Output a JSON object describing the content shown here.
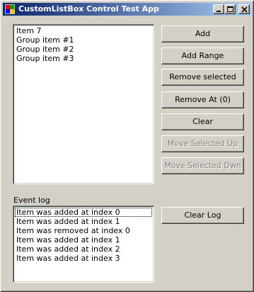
{
  "window": {
    "title": "CustomListBox Control Test App"
  },
  "items_list": {
    "items": [
      "Item 7",
      "Group item #1",
      "Group item #2",
      "Group item #3"
    ]
  },
  "buttons": {
    "add": "Add",
    "add_range": "Add Range",
    "remove_selected": "Remove selected",
    "remove_at": "Remove At (0)",
    "clear": "Clear",
    "move_up": "Move Selected Up",
    "move_down": "Move Selected Dwn",
    "clear_log": "Clear Log"
  },
  "event_log": {
    "label": "Event log",
    "entries": [
      "Item was added at index 0",
      "Item was added at index 1",
      "Item was removed at index 0",
      "Item was added at index 1",
      "Item was added at index 2",
      "Item was added at index 3"
    ]
  },
  "colors": {
    "face": "#d4d0c8",
    "title_start": "#0a246a",
    "title_end": "#a6caf0",
    "disabled_text": "#808080"
  }
}
